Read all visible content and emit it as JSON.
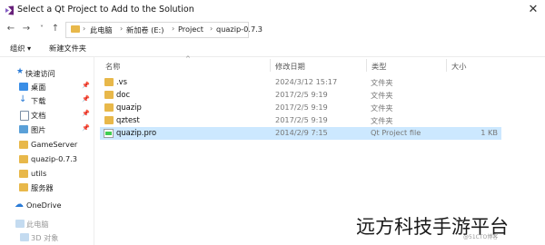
{
  "window": {
    "title": "Select a Qt Project to Add to the Solution",
    "close_glyph": "✕"
  },
  "nav": {
    "back": "←",
    "forward": "→",
    "recent": "˅",
    "up": "↑"
  },
  "breadcrumb": [
    "此电脑",
    "新加卷 (E:)",
    "Project",
    "quazip-0.7.3"
  ],
  "breadcrumb_sep": "›",
  "commands": {
    "organize": "组织 ▾",
    "new_folder": "新建文件夹"
  },
  "sidebar": {
    "quick_access": "快速访问",
    "items": [
      {
        "label": "桌面",
        "pinned": true
      },
      {
        "label": "下载",
        "pinned": true
      },
      {
        "label": "文档",
        "pinned": true
      },
      {
        "label": "图片",
        "pinned": true
      },
      {
        "label": "GameServer",
        "pinned": false
      },
      {
        "label": "quazip-0.7.3",
        "pinned": false
      },
      {
        "label": "utils",
        "pinned": false
      },
      {
        "label": "服务器",
        "pinned": false
      }
    ],
    "onedrive": "OneDrive",
    "this_pc": "此电脑",
    "objects_3d": "3D 对象",
    "pin_glyph": "📌"
  },
  "columns": {
    "name": "名称",
    "modified": "修改日期",
    "type": "类型",
    "size": "大小"
  },
  "files": [
    {
      "name": ".vs",
      "modified": "2024/3/12 15:17",
      "type": "文件夹",
      "size": "",
      "kind": "folder"
    },
    {
      "name": "doc",
      "modified": "2017/2/5 9:19",
      "type": "文件夹",
      "size": "",
      "kind": "folder"
    },
    {
      "name": "quazip",
      "modified": "2017/2/5 9:19",
      "type": "文件夹",
      "size": "",
      "kind": "folder"
    },
    {
      "name": "qztest",
      "modified": "2017/2/5 9:19",
      "type": "文件夹",
      "size": "",
      "kind": "folder"
    },
    {
      "name": "quazip.pro",
      "modified": "2014/2/9 7:15",
      "type": "Qt Project file",
      "size": "1 KB",
      "kind": "qtpro",
      "selected": true
    }
  ],
  "watermark": {
    "text": "远方科技手游平台",
    "sub": "@51CTO博客"
  },
  "colors": {
    "folder": "#e8b84a",
    "selection": "#cce8ff",
    "accent": "#0078d7"
  }
}
